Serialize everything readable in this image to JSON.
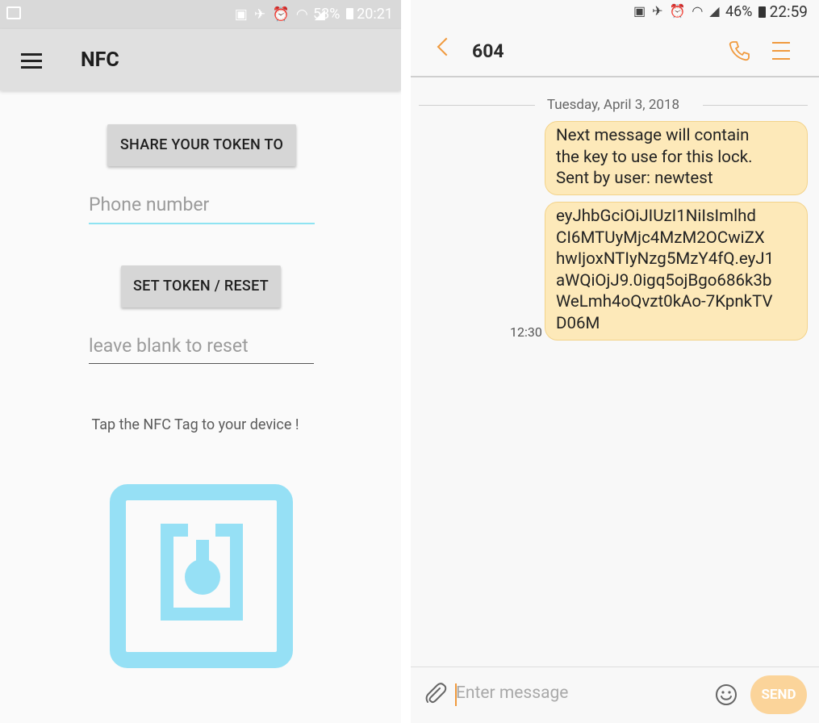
{
  "left_screen": {
    "status_bar": {
      "battery": "53%",
      "time": "20:21"
    },
    "app_bar": {
      "title": "NFC"
    },
    "share_button_label": "SHARE YOUR TOKEN TO",
    "phone_field_placeholder": "Phone number",
    "set_token_button_label": "SET TOKEN / RESET",
    "token_field_placeholder": "leave blank to reset",
    "hint_text": "Tap the NFC Tag to your device !",
    "accent_color": "#8fe3f2"
  },
  "right_screen": {
    "status_bar": {
      "battery": "46%",
      "time": "22:59"
    },
    "contact_name": "604",
    "date_separator": "Tuesday, April 3, 2018",
    "messages": [
      {
        "lines": [
          "Next message will contain",
          "the key to use for this lock.",
          "Sent by user: newtest"
        ]
      },
      {
        "lines": [
          "eyJhbGciOiJIUzI1NiIsImlhd",
          "CI6MTUyMjc4MzM2OCwiZX",
          "hwIjoxNTIyNzg5MzY4fQ.eyJ1",
          "aWQiOjJ9.0igq5ojBgo686k3b",
          "WeLmh4oQvzt0kAo-7KpnkTV",
          "D06M"
        ],
        "time": "12:30"
      }
    ],
    "compose_placeholder": "Enter message",
    "send_label": "SEND",
    "accent_color": "#f09a3e",
    "bubble_color": "#fde9b9"
  }
}
